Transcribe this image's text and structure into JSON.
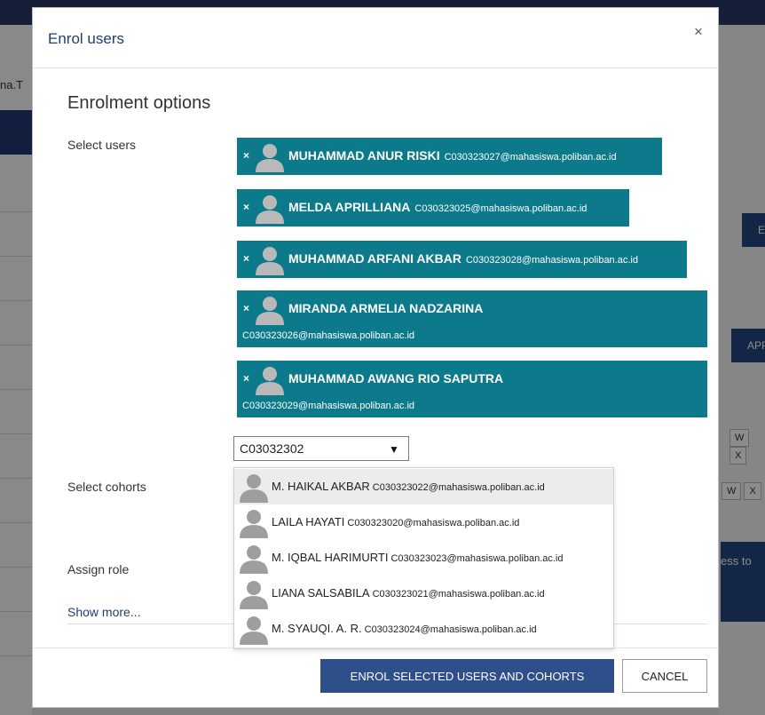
{
  "background": {
    "left_truncated_text": "na.T",
    "right_button_1": "E",
    "right_button_2": "APP",
    "right_wx_1": [
      "W",
      "X"
    ],
    "right_wx_2": [
      "W",
      "X"
    ],
    "right_banner_text": "ess to"
  },
  "modal": {
    "title": "Enrol users",
    "close_label": "×",
    "section_title": "Enrolment options",
    "labels": {
      "select_users": "Select users",
      "select_cohorts": "Select cohorts",
      "assign_role": "Assign role",
      "show_more": "Show more..."
    },
    "remove_symbol": "×",
    "selected_users": [
      {
        "name": "MUHAMMAD ANUR RISKI",
        "email": "C030323027@mahasiswa.poliban.ac.id"
      },
      {
        "name": "MELDA APRILLIANA",
        "email": "C030323025@mahasiswa.poliban.ac.id"
      },
      {
        "name": "MUHAMMAD ARFANI AKBAR",
        "email": "C030323028@mahasiswa.poliban.ac.id"
      },
      {
        "name": "MIRANDA ARMELIA NADZARINA",
        "email": "C030323026@mahasiswa.poliban.ac.id"
      },
      {
        "name": "MUHAMMAD AWANG RIO SAPUTRA",
        "email": "C030323029@mahasiswa.poliban.ac.id"
      }
    ],
    "search": {
      "value": "C03032302",
      "arrow": "▼"
    },
    "suggestions": [
      {
        "name": "M. HAIKAL AKBAR",
        "email": "C030323022@mahasiswa.poliban.ac.id"
      },
      {
        "name": "LAILA HAYATI",
        "email": "C030323020@mahasiswa.poliban.ac.id"
      },
      {
        "name": "M. IQBAL HARIMURTI",
        "email": "C030323023@mahasiswa.poliban.ac.id"
      },
      {
        "name": "LIANA SALSABILA",
        "email": "C030323021@mahasiswa.poliban.ac.id"
      },
      {
        "name": "M. SYAUQI. A. R.",
        "email": "C030323024@mahasiswa.poliban.ac.id"
      }
    ],
    "buttons": {
      "enrol": "ENROL SELECTED USERS AND COHORTS",
      "cancel": "CANCEL"
    }
  },
  "colors": {
    "chip": "#0d7a8c",
    "primary": "#2f4f8a",
    "title": "#1f3d74"
  }
}
